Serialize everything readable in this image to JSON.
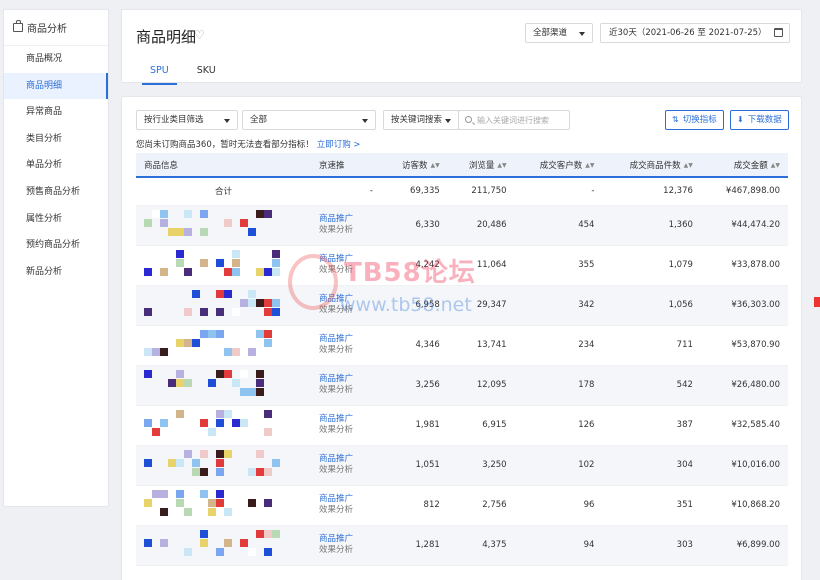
{
  "sidebar": {
    "header": "商品分析",
    "items": [
      {
        "label": "商品概况",
        "active": false
      },
      {
        "label": "商品明细",
        "active": true
      },
      {
        "label": "异常商品",
        "active": false
      },
      {
        "label": "类目分析",
        "active": false
      },
      {
        "label": "单品分析",
        "active": false
      },
      {
        "label": "预售商品分析",
        "active": false
      },
      {
        "label": "属性分析",
        "active": false
      },
      {
        "label": "预约商品分析",
        "active": false
      },
      {
        "label": "新品分析",
        "active": false
      }
    ]
  },
  "header": {
    "title": "商品明细",
    "channel": "全部渠道",
    "date_range": "近30天（2021-06-26 至 2021-07-25）",
    "tabs": [
      {
        "label": "SPU",
        "active": true
      },
      {
        "label": "SKU",
        "active": false
      }
    ]
  },
  "filters": {
    "category_filter": "按行业类目筛选",
    "category_value": "全部",
    "search_mode": "按关键词搜索",
    "search_placeholder": "输入关键词进行搜索",
    "switch_metrics": "切换指标",
    "download": "下载数据",
    "notice": "您尚未订购商品360，暂时无法查看部分指标！",
    "notice_link": "立即订购 >"
  },
  "table": {
    "columns": [
      "商品信息",
      "京速推",
      "访客数",
      "浏览量",
      "成交客户数",
      "成交商品件数",
      "成交金额"
    ],
    "total": {
      "label": "合计",
      "jingsutui": "-",
      "visitors": "69,335",
      "pageviews": "211,750",
      "customers": "-",
      "items": "12,376",
      "amount": "¥467,898.00"
    },
    "link_primary": "商品推广",
    "link_secondary": "效果分析",
    "rows": [
      {
        "visitors": "6,330",
        "pageviews": "20,486",
        "customers": "454",
        "items": "1,360",
        "amount": "¥44,474.20"
      },
      {
        "visitors": "4,242",
        "pageviews": "11,064",
        "customers": "355",
        "items": "1,079",
        "amount": "¥33,878.00"
      },
      {
        "visitors": "6,958",
        "pageviews": "29,347",
        "customers": "342",
        "items": "1,056",
        "amount": "¥36,303.00"
      },
      {
        "visitors": "4,346",
        "pageviews": "13,741",
        "customers": "234",
        "items": "711",
        "amount": "¥53,870.90"
      },
      {
        "visitors": "3,256",
        "pageviews": "12,095",
        "customers": "178",
        "items": "542",
        "amount": "¥26,480.00"
      },
      {
        "visitors": "1,981",
        "pageviews": "6,915",
        "customers": "126",
        "items": "387",
        "amount": "¥32,585.40"
      },
      {
        "visitors": "1,051",
        "pageviews": "3,250",
        "customers": "102",
        "items": "304",
        "amount": "¥10,016.00"
      },
      {
        "visitors": "812",
        "pageviews": "2,756",
        "customers": "96",
        "items": "351",
        "amount": "¥10,868.20"
      },
      {
        "visitors": "1,281",
        "pageviews": "4,375",
        "customers": "94",
        "items": "303",
        "amount": "¥6,899.00"
      }
    ]
  },
  "watermark": {
    "line1": "TB58论坛",
    "line2": "www.tb58.net"
  }
}
